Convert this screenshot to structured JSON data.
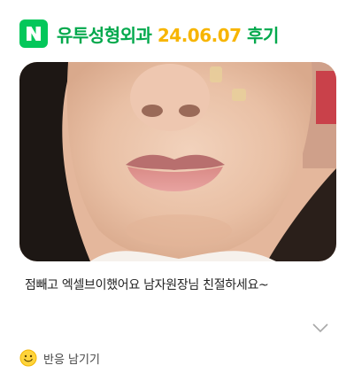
{
  "header": {
    "logo_letter": "N",
    "title_prefix": "유투성형외과",
    "title_date": "24.06.07",
    "title_suffix": "후기",
    "colors": {
      "brand_green": "#03c75a",
      "title_green": "#03a94d",
      "date_yellow": "#f7b500"
    }
  },
  "photo": {
    "icon": "face-photo"
  },
  "post": {
    "caption": "점빼고 엑셀브이했어요 남자원장님 친절하세요~"
  },
  "expand": {
    "icon": "chevron-down-icon"
  },
  "reaction": {
    "icon": "smile-icon",
    "label": "반응 남기기"
  }
}
